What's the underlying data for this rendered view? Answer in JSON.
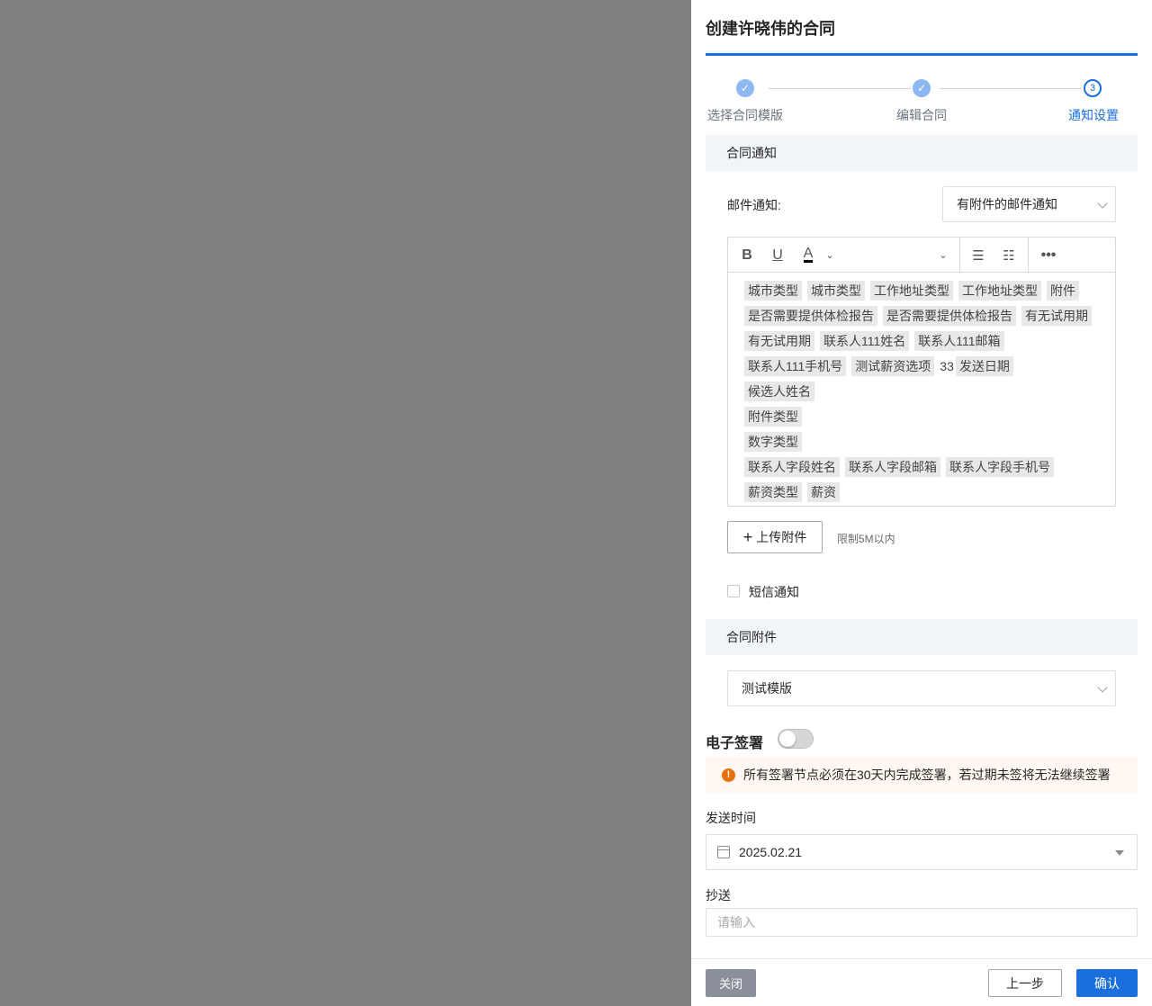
{
  "drawer": {
    "title": "创建许晓伟的合同"
  },
  "steps": [
    {
      "label": "选择合同模版",
      "status": "done",
      "icon": "check-icon"
    },
    {
      "label": "编辑合同",
      "status": "done",
      "icon": "check-icon"
    },
    {
      "label": "通知设置",
      "status": "current",
      "number": "3"
    }
  ],
  "notify": {
    "section_title": "合同通知",
    "email_label": "邮件通知:",
    "email_select_value": "有附件的邮件通知",
    "editor_rows": [
      [
        {
          "t": "城市类型",
          "tag": true
        },
        {
          "t": "城市类型",
          "tag": true
        },
        {
          "t": "工作地址类型",
          "tag": true
        },
        {
          "t": "工作地址类型",
          "tag": true
        },
        {
          "t": "附件",
          "tag": true
        }
      ],
      [
        {
          "t": "是否需要提供体检报告",
          "tag": true
        },
        {
          "t": "是否需要提供体检报告",
          "tag": true
        },
        {
          "t": "有无试用期",
          "tag": true
        }
      ],
      [
        {
          "t": "有无试用期",
          "tag": true
        },
        {
          "t": "联系人111姓名",
          "tag": true
        },
        {
          "t": "联系人111邮箱",
          "tag": true
        }
      ],
      [
        {
          "t": "联系人111手机号",
          "tag": true
        },
        {
          "t": "测试薪资选项",
          "tag": true
        },
        {
          "t": "33",
          "tag": false
        },
        {
          "t": "发送日期",
          "tag": true
        }
      ],
      [
        {
          "t": "候选人姓名",
          "tag": true
        }
      ],
      [
        {
          "t": "附件类型",
          "tag": true
        }
      ],
      [
        {
          "t": "数字类型",
          "tag": true
        }
      ],
      [
        {
          "t": "联系人字段姓名",
          "tag": true
        },
        {
          "t": "联系人字段邮箱",
          "tag": true
        },
        {
          "t": "联系人字段手机号",
          "tag": true
        }
      ],
      [
        {
          "t": "薪资类型",
          "tag": true
        },
        {
          "t": "薪资",
          "tag": true
        }
      ]
    ],
    "upload_label": "上传附件",
    "upload_hint": "限制5M以内",
    "sms_label": "短信通知"
  },
  "attachment": {
    "section_title": "合同附件",
    "template_value": "测试模版"
  },
  "esign": {
    "label": "电子签署",
    "enabled": false,
    "warning": "所有签署节点必须在30天内完成签署，若过期未签将无法继续签署"
  },
  "send_time": {
    "label": "发送时间",
    "value": "2025.02.21"
  },
  "cc": {
    "label": "抄送",
    "placeholder": "请输入"
  },
  "footer": {
    "close": "关闭",
    "prev": "上一步",
    "confirm": "确认"
  },
  "colors": {
    "primary": "#1a6fdc",
    "step_done": "#8cb7f2",
    "warning_icon": "#e8710a"
  }
}
